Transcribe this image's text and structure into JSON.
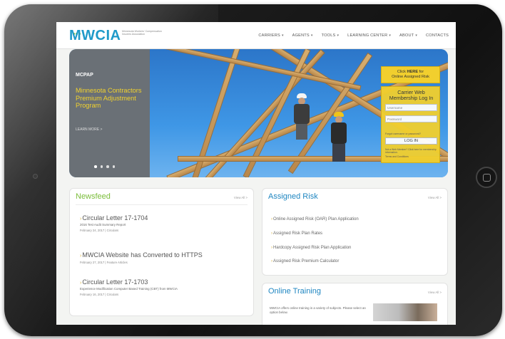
{
  "header": {
    "logo_text": "MWCIA",
    "logo_subtitle": "Minnesota Workers' Compensation Insurers Association",
    "nav": [
      {
        "label": "CARRIERS",
        "caret": "▾"
      },
      {
        "label": "AGENTS",
        "caret": "▾"
      },
      {
        "label": "TOOLS",
        "caret": "▾"
      },
      {
        "label": "LEARNING CENTER",
        "caret": "▾"
      },
      {
        "label": "ABOUT",
        "caret": "▾"
      },
      {
        "label": "CONTACTS",
        "caret": ""
      }
    ]
  },
  "hero": {
    "kicker": "MCPAP",
    "title": "Minnesota Contractors Premium Adjustment Program",
    "learn_more": "LEARN MORE  >",
    "slide_count": 4,
    "active_slide": 1
  },
  "login": {
    "cta_line1": "Click",
    "cta_bold": "HERE",
    "cta_line1_rest": "for",
    "cta_line2": "Online Assigned Risk",
    "heading_line1": "Carrier Web",
    "heading_line2": "Membership Log In",
    "username_placeholder": "Username",
    "password_placeholder": "Password",
    "forgot": "Forgot username or password?",
    "button": "LOG IN",
    "note": "Not a Web Member? Click here for membership information.",
    "terms": "Terms and Conditions"
  },
  "newsfeed": {
    "title": "Newsfeed",
    "view_all": "View All >",
    "items": [
      {
        "title": "Circular Letter 17-1704",
        "subtitle": "2016 Test Audit Summary Report",
        "meta": "February 24, 2017 | Circulars"
      },
      {
        "title": "MWCIA Website has Converted to HTTPS",
        "subtitle": "",
        "meta": "February 27, 2017 | Feature Articles"
      },
      {
        "title": "Circular Letter 17-1703",
        "subtitle": "Experience Modification Computer Based Training (CBT) from MWCIA",
        "meta": "February 16, 2017 | Circulars"
      }
    ]
  },
  "assigned_risk": {
    "title": "Assigned Risk",
    "view_all": "View All >",
    "links": [
      "Online Assigned Risk (OAR) Plan Application",
      "Assigned Risk Plan Rates",
      "Hardcopy Assigned Risk Plan Application",
      "Assigned Risk Premium Calculator"
    ]
  },
  "online_training": {
    "title": "Online Training",
    "view_all": "View All >",
    "text": "MWCIA offers online training in a variety of subjects. Please select an option below."
  },
  "colors": {
    "brand_blue": "#1f86c1",
    "brand_green": "#7bbd3a",
    "accent_yellow": "#f1cf2e",
    "hero_title_yellow": "#f2d22e"
  }
}
